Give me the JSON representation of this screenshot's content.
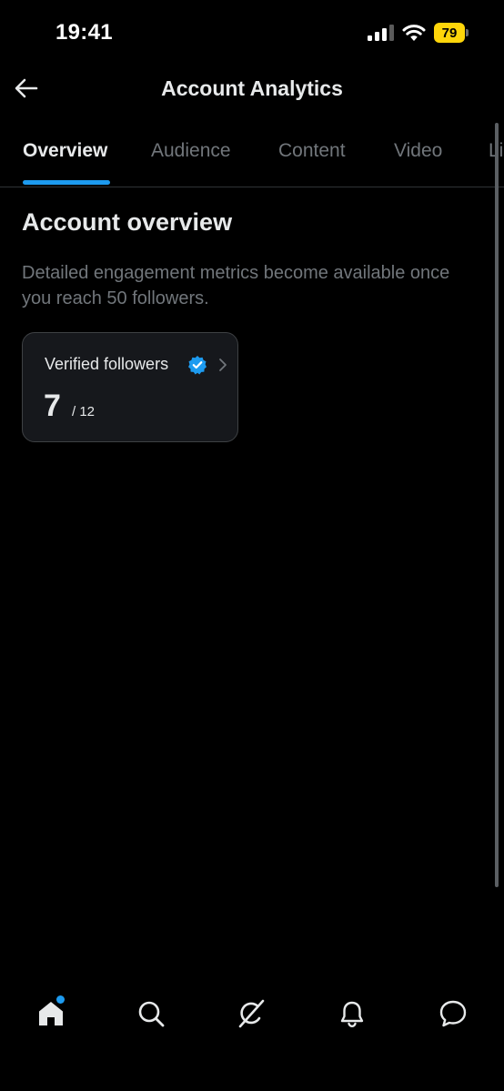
{
  "status_bar": {
    "time": "19:41",
    "battery_level": "79",
    "battery_color": "#ffd60a"
  },
  "header": {
    "title": "Account Analytics",
    "back_icon": "arrow-left-icon"
  },
  "tabs": [
    {
      "label": "Overview",
      "active": true
    },
    {
      "label": "Audience",
      "active": false
    },
    {
      "label": "Content",
      "active": false
    },
    {
      "label": "Video",
      "active": false
    },
    {
      "label": "Li",
      "active": false
    }
  ],
  "overview": {
    "title": "Account overview",
    "description": "Detailed engagement metrics become available once you reach 50 followers."
  },
  "card": {
    "label": "Verified followers",
    "value": "7",
    "total": "/ 12",
    "icons": [
      "verified-badge-icon",
      "chevron-right-icon"
    ]
  },
  "nav": {
    "items": [
      "home-icon",
      "search-icon",
      "grok-icon",
      "bell-icon",
      "messages-icon"
    ],
    "unread_dot_color": "#1d9bf0"
  },
  "colors": {
    "accent": "#1d9bf0",
    "background": "#000000",
    "text_primary": "#e7e9ea",
    "text_secondary": "#71767b"
  }
}
